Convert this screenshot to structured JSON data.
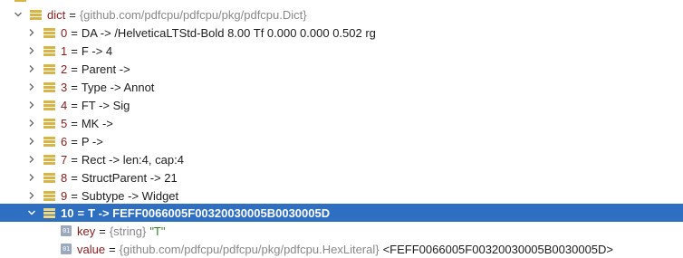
{
  "tree": {
    "root": {
      "name": "dict",
      "type": "{github.com/pdfcpu/pdfcpu/pkg/pdfcpu.Dict}"
    },
    "entries": [
      {
        "index": "0",
        "text": "DA -> /HelveticaLTStd-Bold 8.00 Tf 0.000 0.000 0.502 rg"
      },
      {
        "index": "1",
        "text": "F -> 4"
      },
      {
        "index": "2",
        "text": "Parent ->"
      },
      {
        "index": "3",
        "text": "Type -> Annot"
      },
      {
        "index": "4",
        "text": "FT -> Sig"
      },
      {
        "index": "5",
        "text": "MK ->"
      },
      {
        "index": "6",
        "text": "P ->"
      },
      {
        "index": "7",
        "text": "Rect -> len:4, cap:4"
      },
      {
        "index": "8",
        "text": "StructParent -> 21"
      },
      {
        "index": "9",
        "text": "Subtype -> Widget"
      },
      {
        "index": "10",
        "text": "T -> FEFF0066005F00320030005B0030005D",
        "selected": true
      }
    ],
    "children": [
      {
        "name": "key",
        "type": "{string}",
        "value": "\"T\"",
        "extra": ""
      },
      {
        "name": "value",
        "type": "{github.com/pdfcpu/pdfcpu/pkg/pdfcpu.HexLiteral}",
        "value": "",
        "extra": "<FEFF0066005F00320030005B0030005D>"
      }
    ],
    "icons": {
      "field": "field-icon",
      "primitive": "primitive-icon",
      "primitive_glyph": "01",
      "expand": "chevron-right-icon",
      "collapse": "chevron-down-icon"
    },
    "colors": {
      "selection": "#2f6fc2",
      "name": "#8b1a1a",
      "type": "#888888",
      "string": "#2b8a1e",
      "field_icon": "#d9b548"
    }
  }
}
